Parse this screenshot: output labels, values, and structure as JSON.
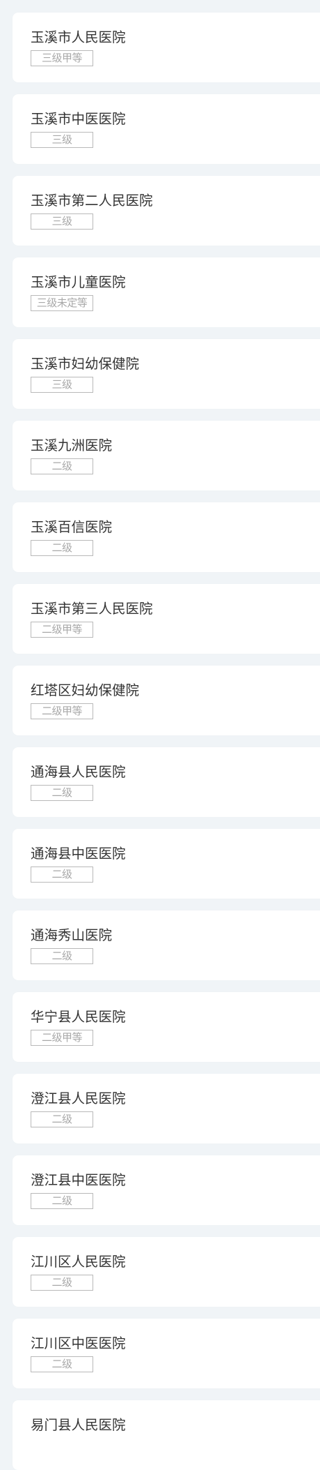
{
  "hospitals": [
    {
      "name": "玉溪市人民医院",
      "level": "三级甲等"
    },
    {
      "name": "玉溪市中医医院",
      "level": "三级"
    },
    {
      "name": "玉溪市第二人民医院",
      "level": "三级"
    },
    {
      "name": "玉溪市儿童医院",
      "level": "三级未定等"
    },
    {
      "name": "玉溪市妇幼保健院",
      "level": "三级"
    },
    {
      "name": "玉溪九洲医院",
      "level": "二级"
    },
    {
      "name": "玉溪百信医院",
      "level": "二级"
    },
    {
      "name": "玉溪市第三人民医院",
      "level": "二级甲等"
    },
    {
      "name": "红塔区妇幼保健院",
      "level": "二级甲等"
    },
    {
      "name": "通海县人民医院",
      "level": "二级"
    },
    {
      "name": "通海县中医医院",
      "level": "二级"
    },
    {
      "name": "通海秀山医院",
      "level": "二级"
    },
    {
      "name": "华宁县人民医院",
      "level": "二级甲等"
    },
    {
      "name": "澄江县人民医院",
      "level": "二级"
    },
    {
      "name": "澄江县中医医院",
      "level": "二级"
    },
    {
      "name": "江川区人民医院",
      "level": "二级"
    },
    {
      "name": "江川区中医医院",
      "level": "二级"
    },
    {
      "name": "易门县人民医院",
      "level": ""
    }
  ]
}
